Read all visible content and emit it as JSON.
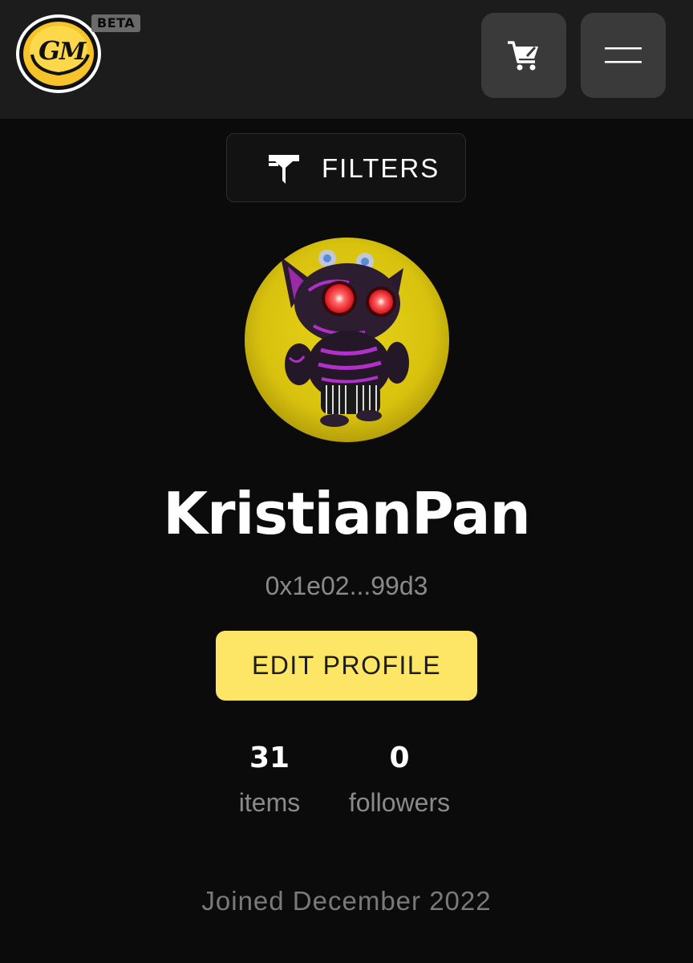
{
  "header": {
    "logo_text": "GM",
    "beta_label": "BETA",
    "cart_icon": "shopping-cart-icon",
    "menu_icon": "hamburger-menu-icon"
  },
  "filters": {
    "icon": "funnel-filter-icon",
    "label": "FILTERS"
  },
  "profile": {
    "avatar": "avatar-image",
    "username": "KristianPan",
    "address": "0x1e02...99d3",
    "edit_label": "EDIT PROFILE",
    "stats": [
      {
        "value": "31",
        "label": "items"
      },
      {
        "value": "0",
        "label": "followers"
      }
    ],
    "joined": "Joined December 2022"
  },
  "colors": {
    "background": "#0b0b0b",
    "header": "#1c1c1c",
    "icon_button": "#3a3a3a",
    "accent_yellow": "#fde566",
    "muted_text": "#8a8a8a"
  }
}
